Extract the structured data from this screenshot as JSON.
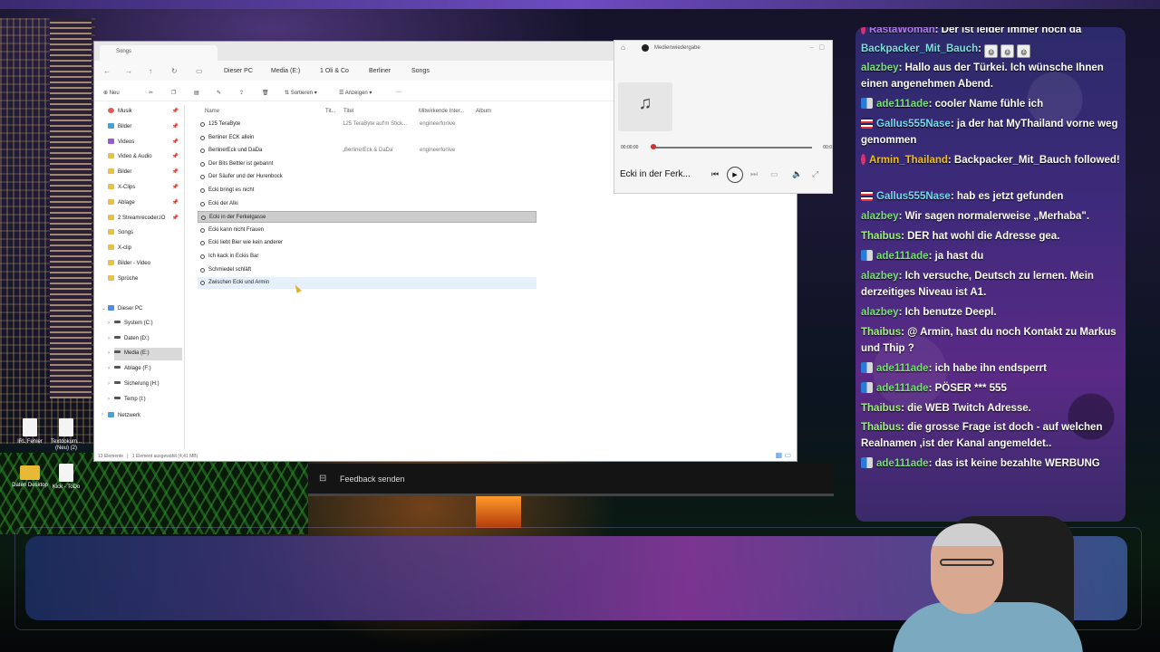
{
  "explorer": {
    "tab_title": "Songs",
    "nav": {
      "back": "←",
      "forward": "→",
      "up": "↑",
      "refresh": "↻"
    },
    "breadcrumb": [
      "Dieser PC",
      "Media (E:)",
      "1 Oli & Co",
      "Berliner",
      "Songs"
    ],
    "toolbar": {
      "new": "Neu",
      "sort": "Sortieren",
      "view": "Anzeigen",
      "more": "···"
    },
    "sidebar_quick": [
      "Musik",
      "Bilder",
      "Videos",
      "Video & Audio",
      "Bilder",
      "X-Clips",
      "Ablage",
      "2 Streamrecoder.IO",
      "Songs",
      "X-clip",
      "Bilder - Video",
      "Sprüche"
    ],
    "sidebar_drives": [
      "Dieser PC",
      "System (C:)",
      "Daten (D:)",
      "Media (E:)",
      "Ablage (F:)",
      "Sicherung (H:)",
      "Temp (I:)",
      "Netzwerk"
    ],
    "columns": [
      "Name",
      "Tit...",
      "Titel",
      "Mitwirkende Inter...",
      "Album"
    ],
    "files": [
      {
        "name": "125 TeraByte",
        "titel": "125 TeraByte auf'm Stick...",
        "artist": "engineerforlive"
      },
      {
        "name": "Berliner ECK allein",
        "titel": "",
        "artist": ""
      },
      {
        "name": "BerlinerEck und DaDa",
        "titel": "„BerlinerEck & DaDa'",
        "artist": "engineerforlive"
      },
      {
        "name": "Der Bits Bettler ist gebannt",
        "titel": "",
        "artist": ""
      },
      {
        "name": "Der Säufer und der Hurenbock",
        "titel": "",
        "artist": ""
      },
      {
        "name": "Ecki bringt es nicht",
        "titel": "",
        "artist": ""
      },
      {
        "name": "Ecki der Alki",
        "titel": "",
        "artist": ""
      },
      {
        "name": "Ecki in der Ferkelgasse",
        "titel": "",
        "artist": ""
      },
      {
        "name": "Ecki kann nicht Frauen",
        "titel": "",
        "artist": ""
      },
      {
        "name": "Ecki liebt Bier wie kein anderer",
        "titel": "",
        "artist": ""
      },
      {
        "name": "Ich kack in Eckis Bar",
        "titel": "",
        "artist": ""
      },
      {
        "name": "Schmiedel schläft",
        "titel": "",
        "artist": ""
      },
      {
        "name": "Zwischen Ecki und Armin",
        "titel": "",
        "artist": ""
      }
    ],
    "status_count": "13 Elemente",
    "status_selected": "1 Element ausgewählt (4,41 MB)"
  },
  "player": {
    "title": "Medienwiedergabe",
    "time_current": "00:00:00",
    "time_total": "00:0",
    "song": "Ecki in der Ferk...",
    "progress": 0.0
  },
  "desktop_icons": [
    {
      "label": "IRL Fehler",
      "kind": "doc"
    },
    {
      "label": "Textdokum... (Neu) (2)",
      "kind": "doc"
    },
    {
      "label": "Daten Desktop",
      "kind": "folder"
    },
    {
      "label": "Kick - ToDo",
      "kind": "doc"
    }
  ],
  "stream_bar": {
    "feedback": "Feedback senden"
  },
  "chat": [
    {
      "user": "RastaWoman",
      "text": ": Der ist leider immer noch da",
      "color": "#b07be0",
      "badge": "sub"
    },
    {
      "user": "Backpacker_Mit_Bauch",
      "text": ":",
      "color": "#7be0e0",
      "badge": "",
      "emotes": 3
    },
    {
      "user": "alazbey",
      "text": ": Hallo aus der Türkei. Ich wünsche Ihnen einen angenehmen Abend.",
      "color": "#7be07b",
      "badge": ""
    },
    {
      "user": "ade111ade",
      "text": ": cooler Name fühle ich",
      "color": "#7be07b",
      "badge": "mod"
    },
    {
      "user": "Gallus555Nase",
      "text": ": ja der hat MyThailand vorne weg genommen",
      "color": "#7bd8f0",
      "badge": "th"
    },
    {
      "user": "Armin_Thailand",
      "text": ": Backpacker_Mit_Bauch followed!",
      "color": "#f0c020",
      "badge": "sub"
    },
    {
      "user": "Gallus555Nase",
      "text": ": hab es jetzt gefunden",
      "color": "#7bd8f0",
      "badge": "th"
    },
    {
      "user": "alazbey",
      "text": ": Wir sagen normalerweise „Merhaba\".",
      "color": "#7be07b",
      "badge": ""
    },
    {
      "user": "Thaibus",
      "text": ": DER hat wohl die Adresse gea.",
      "color": "#a0f080",
      "badge": ""
    },
    {
      "user": "ade111ade",
      "text": ": ja hast du",
      "color": "#7be07b",
      "badge": "mod"
    },
    {
      "user": "alazbey",
      "text": ": Ich versuche, Deutsch zu lernen. Mein derzeitiges Niveau ist A1.",
      "color": "#7be07b",
      "badge": ""
    },
    {
      "user": "alazbey",
      "text": ": Ich benutze Deepl.",
      "color": "#7be07b",
      "badge": ""
    },
    {
      "user": "Thaibus",
      "text": ": @ Armin, hast du noch Kontakt zu Markus und Thip ?",
      "color": "#a0f080",
      "badge": ""
    },
    {
      "user": "ade111ade",
      "text": ": ich habe ihn endsperrt",
      "color": "#7be07b",
      "badge": "mod"
    },
    {
      "user": "ade111ade",
      "text": ": PÖSER *** 555",
      "color": "#7be07b",
      "badge": "mod"
    },
    {
      "user": "Thaibus",
      "text": ": die WEB Twitch Adresse.",
      "color": "#a0f080",
      "badge": ""
    },
    {
      "user": "Thaibus",
      "text": ": die grosse Frage ist doch - auf welchen Realnamen ,ist der Kanal angemeldet..",
      "color": "#a0f080",
      "badge": ""
    },
    {
      "user": "ade111ade",
      "text": ": das ist keine bezahlte WERBUNG",
      "color": "#7be07b",
      "badge": "mod"
    }
  ]
}
